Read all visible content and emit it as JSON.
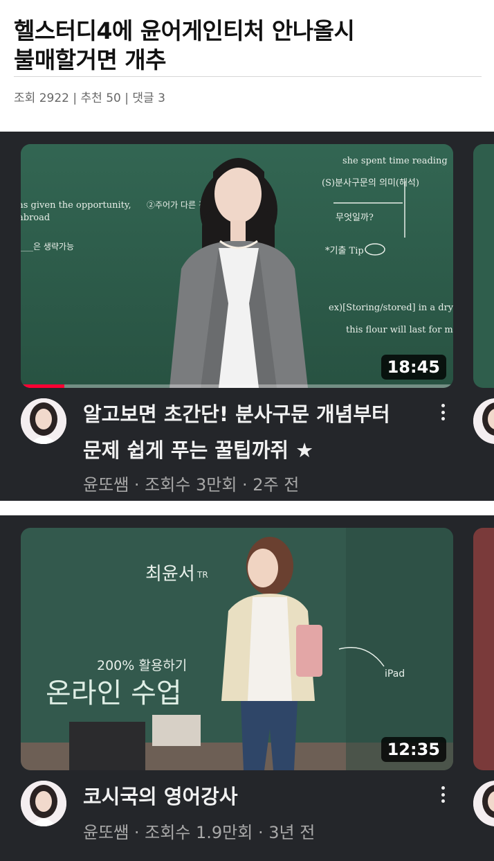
{
  "post": {
    "title_line1": "헬스터디4에 윤어게인티처 안나올시",
    "title_line2": "불매할거면 개추",
    "meta_views_label": "조회",
    "meta_views": "2922",
    "meta_sep": " | ",
    "meta_likes_label": "추천",
    "meta_likes": "50",
    "meta_comments_label": "댓글",
    "meta_comments": "3"
  },
  "videos": [
    {
      "title_line1": "알고보면 초간단! 분사구문 개념부터",
      "title_line2": "문제 쉽게 푸는 꿀팁까쥐 ★",
      "meta": "윤또쌤 · 조회수 3만회 · 2주 전",
      "duration": "18:45",
      "progress": 0.1,
      "board_text": {
        "t1": "she spent time reading",
        "t2": "(S)분사구문의 의미(해석)",
        "t3": "as given the opportunity,",
        "t4": "abroad",
        "t5": "②주어가 다른 경우",
        "t6": "무엇일까?",
        "t7": "___은 생략가능",
        "t8": "*기출 Tip",
        "t9": "ex)[Storing/stored] in a dry pl",
        "t10": "this flour will last for mont"
      }
    },
    {
      "title_line1": "코시국의 영어강사",
      "meta": "윤또쌤 · 조회수 1.9만회 · 3년 전",
      "duration": "12:35",
      "board_text": {
        "t1": "최윤서",
        "t2": "TR",
        "t3": "200% 활용하기",
        "t4": "온라인 수업",
        "t5": "iPad"
      }
    }
  ],
  "colors": {
    "card_bg": "#24262a",
    "chalkboard": "#2f5e4c",
    "progress": "#ff0033"
  }
}
